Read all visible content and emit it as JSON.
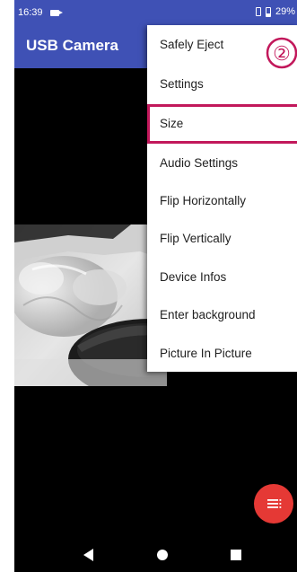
{
  "status_bar": {
    "time": "16:39",
    "battery": "29%"
  },
  "app_bar": {
    "title": "USB Camera"
  },
  "menu": {
    "items": [
      {
        "label": "Safely Eject"
      },
      {
        "label": "Settings"
      },
      {
        "label": "Size"
      },
      {
        "label": "Audio Settings"
      },
      {
        "label": "Flip Horizontally"
      },
      {
        "label": "Flip Vertically"
      },
      {
        "label": "Device Infos"
      },
      {
        "label": "Enter background"
      },
      {
        "label": "Picture In Picture"
      }
    ],
    "highlighted_item": "Size"
  },
  "annotation": {
    "step_marker": "②"
  },
  "colors": {
    "app_bar": "#3f51b5",
    "highlight": "#c2185b",
    "fab": "#e53935"
  },
  "icons": {
    "fab": "menu-lines-icon",
    "nav_back": "back-triangle-icon",
    "nav_home": "home-circle-icon",
    "nav_recents": "recents-square-icon"
  }
}
